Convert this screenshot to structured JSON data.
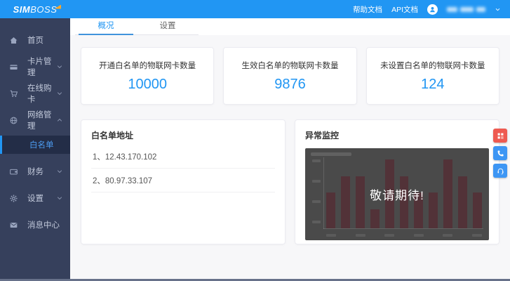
{
  "brand": {
    "name_bold": "SIM",
    "name_light": "BOSS"
  },
  "topbar": {
    "links": [
      {
        "label": "帮助文档"
      },
      {
        "label": "API文档"
      }
    ],
    "user_phone_obscured": true
  },
  "tabs": [
    {
      "label": "概况",
      "active": true
    },
    {
      "label": "设置",
      "active": false
    }
  ],
  "sidebar": {
    "items": [
      {
        "label": "首页",
        "icon": "home-icon"
      },
      {
        "label": "卡片管理",
        "icon": "card-icon",
        "chevron": "down"
      },
      {
        "label": "在线购卡",
        "icon": "cart-icon",
        "chevron": "down"
      },
      {
        "label": "网络管理",
        "icon": "network-icon",
        "chevron": "up",
        "expanded": true
      },
      {
        "label": "白名单",
        "submenu": true,
        "active": true
      },
      {
        "label": "财务",
        "icon": "wallet-icon",
        "chevron": "down"
      },
      {
        "label": "设置",
        "icon": "gear-icon",
        "chevron": "down"
      },
      {
        "label": "消息中心",
        "icon": "mail-icon"
      }
    ]
  },
  "stats": [
    {
      "title": "开通白名单的物联网卡数量",
      "value": "10000"
    },
    {
      "title": "生效白名单的物联网卡数量",
      "value": "9876"
    },
    {
      "title": "未设置白名单的物联网卡数量",
      "value": "124"
    }
  ],
  "whitelist_panel": {
    "title": "白名单地址",
    "items": [
      "1、12.43.170.102",
      "2、80.97.33.107"
    ]
  },
  "monitor_panel": {
    "title": "异常监控",
    "overlay_text": "敬请期待!"
  },
  "floating_buttons": [
    {
      "icon": "qrcode-icon",
      "color": "#ee5a51"
    },
    {
      "icon": "phone-icon",
      "color": "#3d96f4"
    },
    {
      "icon": "headset-icon",
      "color": "#3d96f4"
    }
  ],
  "chart_data": {
    "type": "bar",
    "values": [
      50,
      72,
      72,
      26,
      95,
      72,
      50,
      50,
      95,
      72,
      50
    ],
    "categories": [
      "",
      "",
      "",
      "",
      "",
      "",
      "",
      "",
      "",
      "",
      ""
    ],
    "title": "",
    "xlabel": "",
    "ylabel": "",
    "ylim": [
      0,
      100
    ],
    "grid": false,
    "legend": false,
    "overlay_text": "敬请期待!",
    "style_note": "dimmed placeholder bar chart, axis labels illegible"
  },
  "colors": {
    "accent_blue": "#2196f3",
    "sidebar_bg": "#36405c",
    "submenu_active_bg": "#232d47",
    "content_bg": "#f7f7f9",
    "stat_value": "#2196f3",
    "fab_red": "#ee5a51",
    "fab_blue": "#3d96f4",
    "chart_bg": "#4a4a4a",
    "chart_bar": "#523238",
    "logo_accent": "#ffa726"
  }
}
